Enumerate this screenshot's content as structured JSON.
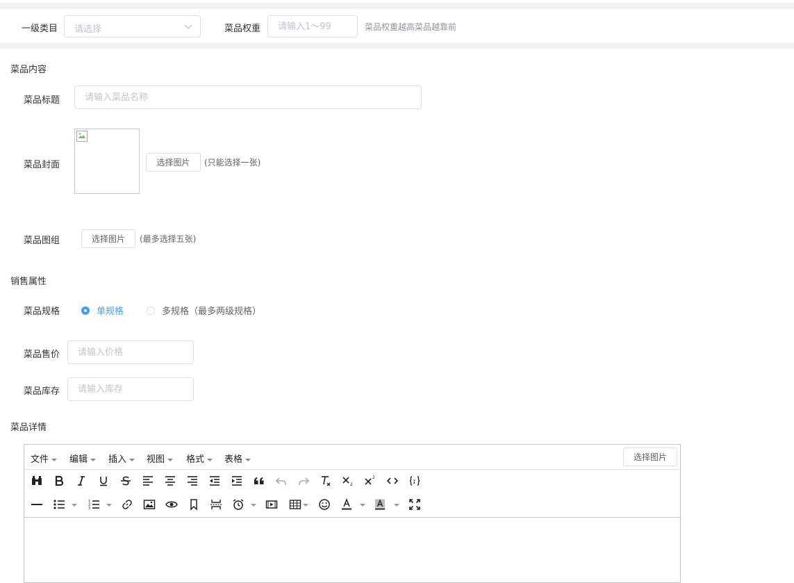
{
  "category": {
    "label": "一级类目",
    "placeholder": "请选择"
  },
  "weight": {
    "label": "菜品权重",
    "placeholder": "请输入1～99",
    "hint": "菜品权重越高菜品越靠前"
  },
  "content_section": "菜品内容",
  "title_field": {
    "label": "菜品标题",
    "placeholder": "请输入菜品名称"
  },
  "cover": {
    "label": "菜品封面",
    "button": "选择图片",
    "note": "(只能选择一张)"
  },
  "gallery": {
    "label": "菜品图组",
    "button": "选择图片",
    "note": "(最多选择五张)"
  },
  "sale_section": "销售属性",
  "spec": {
    "label": "菜品规格",
    "options": [
      {
        "label": "单规格",
        "checked": true
      },
      {
        "label": "多规格（最多两级规格）",
        "checked": false
      }
    ]
  },
  "price": {
    "label": "菜品售价",
    "placeholder": "请输入价格"
  },
  "stock": {
    "label": "菜品库存",
    "placeholder": "请输入库存"
  },
  "detail_section": "菜品详情",
  "editor": {
    "menus": [
      "文件",
      "编辑",
      "插入",
      "视图",
      "格式",
      "表格"
    ],
    "image_button": "选择图片",
    "row1_icons": [
      "find-replace-icon",
      "bold-icon",
      "italic-icon",
      "underline-icon",
      "strikethrough-icon",
      "align-left-icon",
      "align-center-icon",
      "align-right-icon",
      "outdent-icon",
      "indent-icon",
      "blockquote-icon",
      "undo-icon",
      "redo-icon",
      "clear-format-icon",
      "subscript-icon",
      "superscript-icon",
      "code-icon",
      "code-sample-icon"
    ],
    "row2_icons": [
      "horizontal-rule-icon",
      "bullet-list-icon",
      "numbered-list-icon",
      "link-icon",
      "image-icon",
      "preview-icon",
      "bookmark-icon",
      "page-break-icon",
      "insert-datetime-icon",
      "media-icon",
      "table-icon",
      "emoticons-icon",
      "text-color-icon",
      "background-color-icon",
      "fullscreen-icon"
    ]
  },
  "colors": {
    "accent": "#409eff",
    "border": "#dcdfe6",
    "placeholder": "#c0c4cc",
    "band": "#f2f2f2"
  }
}
